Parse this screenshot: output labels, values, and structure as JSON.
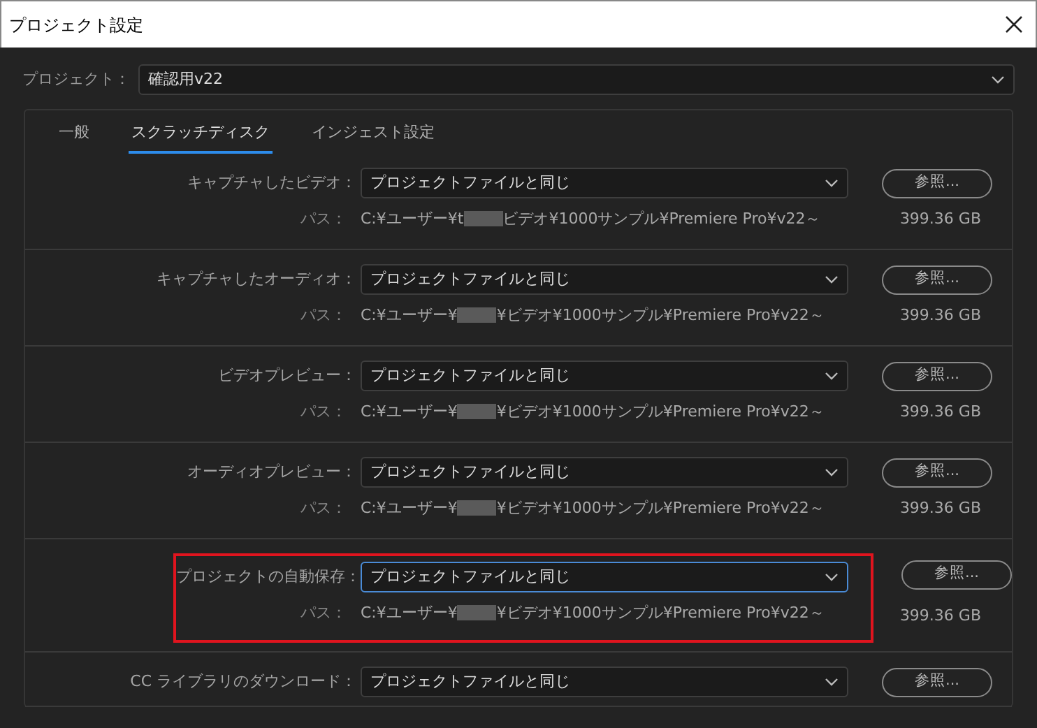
{
  "window": {
    "title": "プロジェクト設定"
  },
  "project": {
    "label": "プロジェクト：",
    "value": "確認用v22"
  },
  "tabs": [
    {
      "label": "一般",
      "selected": false
    },
    {
      "label": "スクラッチディスク",
      "selected": true
    },
    {
      "label": "インジェスト設定",
      "selected": false
    }
  ],
  "rows": [
    {
      "label": "キャプチャしたビデオ：",
      "value": "プロジェクトファイルと同じ",
      "button": "参照...",
      "path_label": "パス：",
      "path_before": "C:¥ユーザー¥t",
      "path_after": "ビデオ¥1000サンプル¥Premiere Pro¥v22～",
      "size": "399.36 GB",
      "focused": false,
      "highlighted": false
    },
    {
      "label": "キャプチャしたオーディオ：",
      "value": "プロジェクトファイルと同じ",
      "button": "参照...",
      "path_label": "パス：",
      "path_before": "C:¥ユーザー¥",
      "path_after": "¥ビデオ¥1000サンプル¥Premiere Pro¥v22～",
      "size": "399.36 GB",
      "focused": false,
      "highlighted": false
    },
    {
      "label": "ビデオプレビュー：",
      "value": "プロジェクトファイルと同じ",
      "button": "参照...",
      "path_label": "パス：",
      "path_before": "C:¥ユーザー¥",
      "path_after": "¥ビデオ¥1000サンプル¥Premiere Pro¥v22～",
      "size": "399.36 GB",
      "focused": false,
      "highlighted": false
    },
    {
      "label": "オーディオプレビュー：",
      "value": "プロジェクトファイルと同じ",
      "button": "参照...",
      "path_label": "パス：",
      "path_before": "C:¥ユーザー¥",
      "path_after": "¥ビデオ¥1000サンプル¥Premiere Pro¥v22～",
      "size": "399.36 GB",
      "focused": false,
      "highlighted": false
    },
    {
      "label": "プロジェクトの自動保存：",
      "value": "プロジェクトファイルと同じ",
      "button": "参照...",
      "path_label": "パス：",
      "path_before": "C:¥ユーザー¥",
      "path_after": "¥ビデオ¥1000サンプル¥Premiere Pro¥v22～",
      "size": "399.36 GB",
      "focused": true,
      "highlighted": true
    },
    {
      "label": "CC ライブラリのダウンロード：",
      "value": "プロジェクトファイルと同じ",
      "button": "参照...",
      "focused": false,
      "highlighted": false
    }
  ]
}
